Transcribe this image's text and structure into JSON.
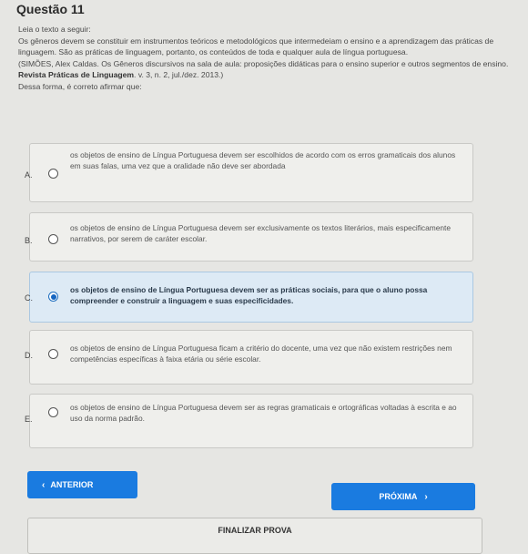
{
  "question": {
    "title": "Questão 11",
    "instruction": "Leia o texto a seguir:",
    "text": "Os gêneros devem se constituir em instrumentos teóricos e metodológicos que intermedeiam o ensino e a aprendizagem das práticas de linguagem. São as práticas de linguagem, portanto, os conteúdos de toda e qualquer aula de língua portuguesa.",
    "reference_authors": "(SIMÕES, Alex Caldas. Os Gêneros discursivos na sala de aula: proposições didáticas para o ensino superior e outros segmentos de ensino.",
    "reference_journal": "Revista Práticas de Linguagem",
    "reference_tail": ". v. 3, n. 2, jul./dez. 2013.)",
    "prompt": "Dessa forma, é correto afirmar que:"
  },
  "options": [
    {
      "letter": "A.",
      "text": "os objetos de ensino de Língua Portuguesa devem ser escolhidos de acordo com os erros gramaticais dos alunos em suas falas, uma vez que a oralidade não deve ser abordada",
      "selected": false
    },
    {
      "letter": "B.",
      "text": "os objetos de ensino de Língua Portuguesa devem ser exclusivamente os textos literários, mais especificamente narrativos, por serem de caráter escolar.",
      "selected": false
    },
    {
      "letter": "C.",
      "text": "os objetos de ensino de Língua Portuguesa devem ser as práticas sociais, para que o aluno possa compreender e construir a linguagem e suas especificidades.",
      "selected": true
    },
    {
      "letter": "D.",
      "text": "os objetos de ensino de Língua Portuguesa ficam a critério do docente, uma vez que não existem restrições nem competências específicas à faixa etária ou série escolar.",
      "selected": false
    },
    {
      "letter": "E.",
      "text": "os objetos de ensino de Língua Portuguesa devem ser as regras gramaticais e ortográficas voltadas à escrita e ao uso da norma padrão.",
      "selected": false
    }
  ],
  "nav": {
    "prev_label": "ANTERIOR",
    "next_label": "PRÓXIMA",
    "prev_icon": "‹",
    "next_icon": "›",
    "finalize_label": "FINALIZAR PROVA"
  },
  "colors": {
    "accent": "#1a7be0",
    "selected_bg": "#ddeaf5"
  }
}
